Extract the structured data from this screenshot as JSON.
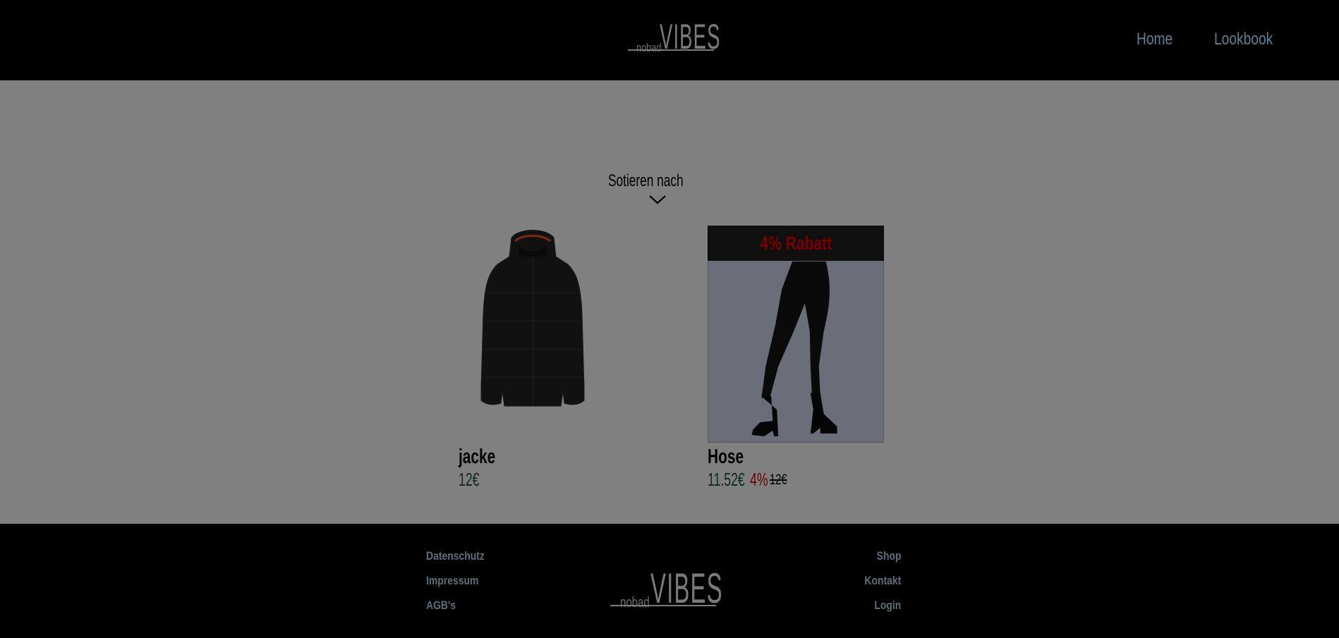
{
  "brand": {
    "prefix": "nobad",
    "name": "VIBES"
  },
  "nav": {
    "home": "Home",
    "lookbook": "Lookbook"
  },
  "sort": {
    "label": "Sotieren nach"
  },
  "products": [
    {
      "name": "jacke",
      "price": "12€"
    },
    {
      "name": "Hose",
      "badge": "4% Rabatt",
      "price": "11.52€",
      "discount": "4%",
      "old_price": "12€"
    }
  ],
  "footer": {
    "left_links": [
      "Datenschutz",
      "Impressum",
      "AGB's"
    ],
    "right_links": [
      "Shop",
      "Kontakt",
      "Login"
    ]
  },
  "icons": {
    "sort": "chevron-down-icon"
  },
  "colors": {
    "header_bg": "#000000",
    "page_bg": "#808080",
    "nav_link": "#5f8194",
    "badge_text": "#7a0000"
  }
}
